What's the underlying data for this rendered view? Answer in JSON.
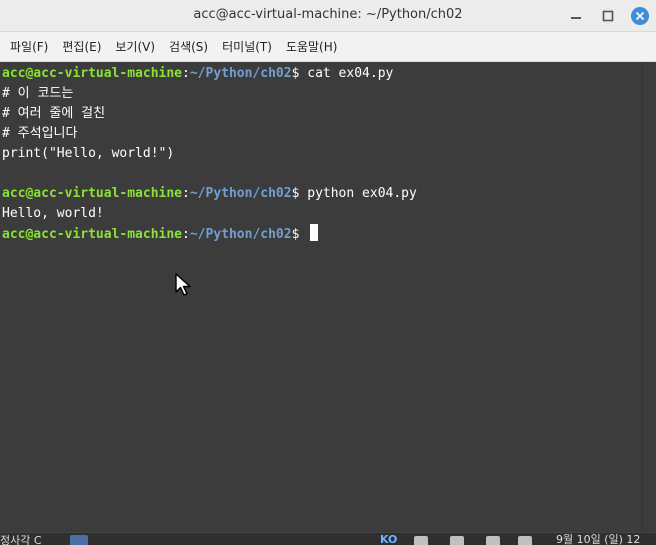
{
  "window": {
    "title": "acc@acc-virtual-machine: ~/Python/ch02"
  },
  "menu": [
    {
      "label": "파일(F)"
    },
    {
      "label": "편집(E)"
    },
    {
      "label": "보기(V)"
    },
    {
      "label": "검색(S)"
    },
    {
      "label": "터미널(T)"
    },
    {
      "label": "도움말(H)"
    }
  ],
  "terminal": {
    "user_host": "acc@acc-virtual-machine",
    "sep": ":",
    "path": "~/Python/ch02",
    "prompt": "$ ",
    "cmd1": "cat ex04.py",
    "file_lines": [
      "# 이 코드는",
      "# 여러 줄에 걸친",
      "# 주석입니다",
      "print(\"Hello, world!\")"
    ],
    "cmd2": "python ex04.py",
    "output": "Hello, world!"
  },
  "taskbar": {
    "left_label": "정사각 C",
    "kb": "KO",
    "clock": "9월 10일 (일) 12"
  },
  "colors": {
    "terminal_bg": "#3c3c3c",
    "prompt_user": "#8ae234",
    "prompt_path": "#729fcf",
    "close_button": "#3e8ed8"
  }
}
